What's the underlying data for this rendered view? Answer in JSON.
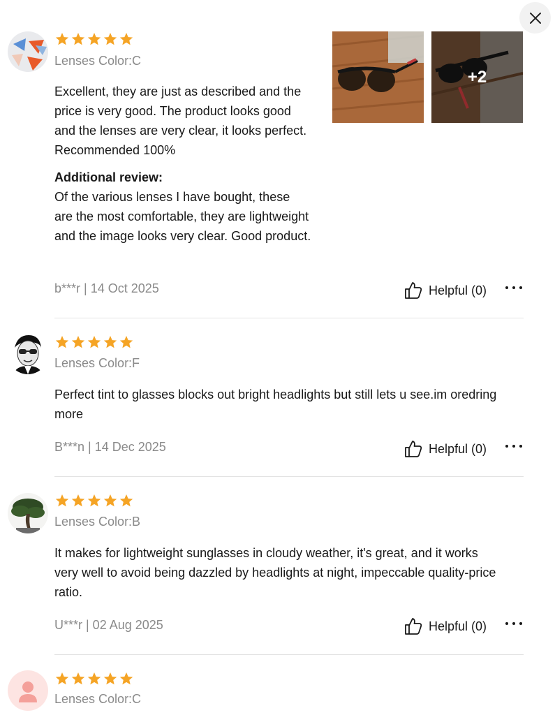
{
  "reviews": [
    {
      "rating": 5,
      "variant": "Lenses Color:C",
      "text": "Excellent, they are just as described and the price is very good. The product looks good and the lenses are very clear, it looks perfect. Recommended 100%",
      "additional_title": "Additional review:",
      "additional_text": "Of the various lenses I have bought, these are the most comfortable, they are lightweight and the image looks very clear. Good product.",
      "author_date": "b***r | 14 Oct 2025",
      "helpful": "Helpful (0)",
      "photo_more": "+2"
    },
    {
      "rating": 5,
      "variant": "Lenses Color:F",
      "text": "Perfect tint to glasses blocks out bright headlights but still lets u see.im oredring more",
      "author_date": "B***n | 14 Dec 2025",
      "helpful": "Helpful (0)"
    },
    {
      "rating": 5,
      "variant": "Lenses Color:B",
      "text": "It makes for lightweight sunglasses in cloudy weather, it's great, and it works very well to avoid being dazzled by headlights at night, impeccable quality-price ratio.",
      "author_date": "U***r | 02 Aug 2025",
      "helpful": "Helpful (0)"
    },
    {
      "rating": 5,
      "variant": "Lenses Color:C"
    }
  ],
  "colors": {
    "star": "#f5a425",
    "muted": "#8a8a8a",
    "text": "#191919"
  },
  "icons": {
    "close": "close-icon",
    "helpful": "thumbs-up-icon",
    "more": "more-dots-icon"
  }
}
